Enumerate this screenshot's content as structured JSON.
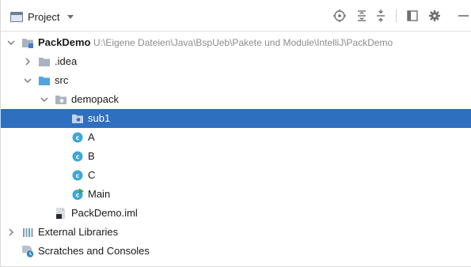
{
  "header": {
    "title": "Project",
    "icons": [
      "project-view-icon",
      "chevron-down-icon",
      "locate-icon",
      "expand-all-icon",
      "collapse-all-icon",
      "split-view-icon",
      "gear-icon",
      "minimize-icon"
    ]
  },
  "tree": {
    "root": {
      "label": "PackDemo",
      "path": "U:\\Eigene Dateien\\Java\\BspUeb\\Pakete und Module\\IntelliJ\\PackDemo",
      "icon": "module-folder-icon"
    },
    "idea": {
      "label": ".idea",
      "icon": "folder-icon"
    },
    "src": {
      "label": "src",
      "icon": "source-folder-icon"
    },
    "demopack": {
      "label": "demopack",
      "icon": "package-icon"
    },
    "sub1": {
      "label": "sub1",
      "icon": "package-icon"
    },
    "classA": {
      "label": "A",
      "icon": "class-icon"
    },
    "classB": {
      "label": "B",
      "icon": "class-icon"
    },
    "classC": {
      "label": "C",
      "icon": "class-icon"
    },
    "main": {
      "label": "Main",
      "icon": "main-class-icon"
    },
    "iml": {
      "label": "PackDemo.iml",
      "icon": "iml-file-icon"
    },
    "libraries": {
      "label": "External Libraries",
      "icon": "libraries-icon"
    },
    "scratches": {
      "label": "Scratches and Consoles",
      "icon": "scratches-icon"
    }
  },
  "colors": {
    "selection": "#2f6fc0",
    "folder": "#a9b3bd",
    "source_folder": "#4fa4e0",
    "class_icon": "#40a6d6"
  }
}
